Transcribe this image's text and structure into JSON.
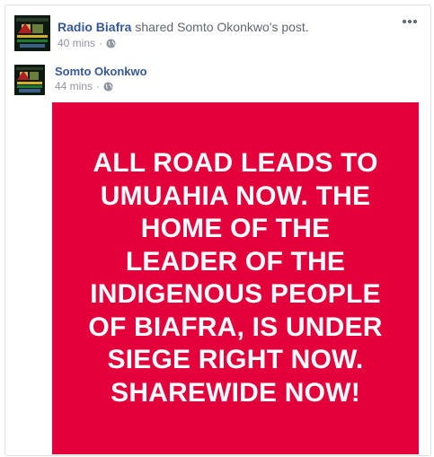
{
  "share": {
    "page_name": "Radio Biafra",
    "action_text": "shared",
    "target_text": "Somto Okonkwo's post.",
    "time": "40 mins",
    "dot": "·",
    "privacy_icon": "globe-icon"
  },
  "original": {
    "author": "Somto Okonkwo",
    "time": "44 mins",
    "dot": "·",
    "privacy_icon": "globe-icon"
  },
  "post_image": {
    "text": "ALL ROAD LEADS TO UMUAHIA NOW. THE HOME OF THE LEADER OF THE INDIGENOUS PEOPLE OF BIAFRA, IS UNDER SIEGE RIGHT NOW. SHAREWIDE NOW!",
    "background": "#e4003a",
    "text_color": "#ffffff"
  },
  "menu": {
    "icon": "more-options-icon"
  },
  "colors": {
    "link": "#365899",
    "meta": "#90949c"
  }
}
